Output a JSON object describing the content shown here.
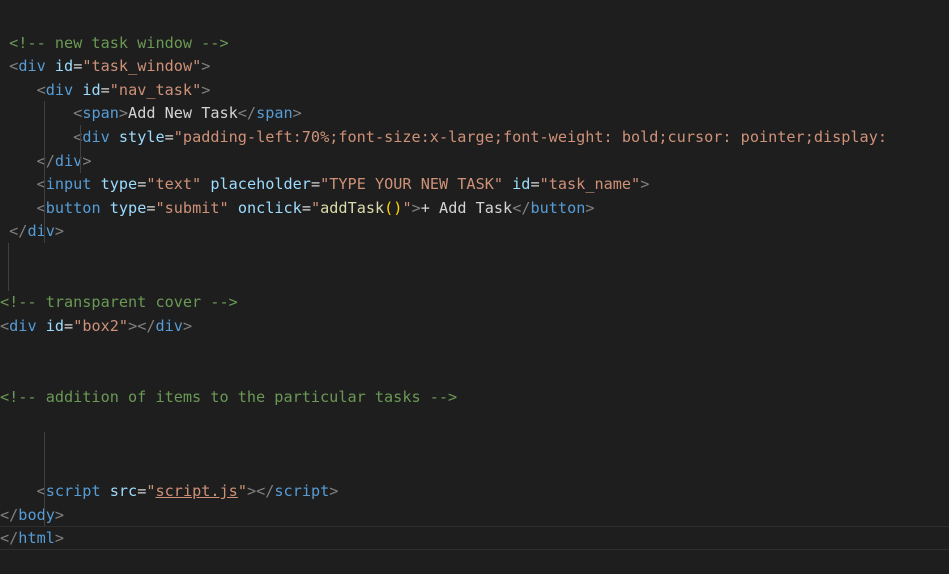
{
  "code_lines": [
    {
      "id": "l01",
      "kind": "blank",
      "tokens": []
    },
    {
      "id": "l02",
      "kind": "comment",
      "tokens": [
        {
          "t": "c",
          "v": " <!-- new task window -->"
        }
      ]
    },
    {
      "id": "l03",
      "kind": "tag",
      "tokens": [
        {
          "t": "txt",
          "v": " "
        },
        {
          "t": "p",
          "v": "<"
        },
        {
          "t": "tag",
          "v": "div"
        },
        {
          "t": "txt",
          "v": " "
        },
        {
          "t": "attr",
          "v": "id"
        },
        {
          "t": "txt",
          "v": "="
        },
        {
          "t": "str",
          "v": "\"task_window\""
        },
        {
          "t": "p",
          "v": ">"
        }
      ]
    },
    {
      "id": "l04",
      "kind": "tag",
      "tokens": [
        {
          "t": "txt",
          "v": "    "
        },
        {
          "t": "p",
          "v": "<"
        },
        {
          "t": "tag",
          "v": "div"
        },
        {
          "t": "txt",
          "v": " "
        },
        {
          "t": "attr",
          "v": "id"
        },
        {
          "t": "txt",
          "v": "="
        },
        {
          "t": "str",
          "v": "\"nav_task\""
        },
        {
          "t": "p",
          "v": ">"
        }
      ]
    },
    {
      "id": "l05",
      "kind": "tag",
      "tokens": [
        {
          "t": "txt",
          "v": "        "
        },
        {
          "t": "p",
          "v": "<"
        },
        {
          "t": "tag",
          "v": "span"
        },
        {
          "t": "p",
          "v": ">"
        },
        {
          "t": "txt",
          "v": "Add New Task"
        },
        {
          "t": "p",
          "v": "</"
        },
        {
          "t": "tag",
          "v": "span"
        },
        {
          "t": "p",
          "v": ">"
        }
      ]
    },
    {
      "id": "l06",
      "kind": "tag",
      "tokens": [
        {
          "t": "txt",
          "v": "        "
        },
        {
          "t": "p",
          "v": "<"
        },
        {
          "t": "tag",
          "v": "div"
        },
        {
          "t": "txt",
          "v": " "
        },
        {
          "t": "attr",
          "v": "style"
        },
        {
          "t": "txt",
          "v": "="
        },
        {
          "t": "str",
          "v": "\"padding-left:70%;font-size:x-large;font-weight: bold;cursor: pointer;display: "
        }
      ]
    },
    {
      "id": "l07",
      "kind": "tag",
      "tokens": [
        {
          "t": "txt",
          "v": "    "
        },
        {
          "t": "p",
          "v": "</"
        },
        {
          "t": "tag",
          "v": "div"
        },
        {
          "t": "p",
          "v": ">"
        }
      ]
    },
    {
      "id": "l08",
      "kind": "tag",
      "tokens": [
        {
          "t": "txt",
          "v": "    "
        },
        {
          "t": "p",
          "v": "<"
        },
        {
          "t": "tag",
          "v": "input"
        },
        {
          "t": "txt",
          "v": " "
        },
        {
          "t": "attr",
          "v": "type"
        },
        {
          "t": "txt",
          "v": "="
        },
        {
          "t": "str",
          "v": "\"text\""
        },
        {
          "t": "txt",
          "v": " "
        },
        {
          "t": "attr",
          "v": "placeholder"
        },
        {
          "t": "txt",
          "v": "="
        },
        {
          "t": "str",
          "v": "\"TYPE YOUR NEW TASK\""
        },
        {
          "t": "txt",
          "v": " "
        },
        {
          "t": "attr",
          "v": "id"
        },
        {
          "t": "txt",
          "v": "="
        },
        {
          "t": "str",
          "v": "\"task_name\""
        },
        {
          "t": "p",
          "v": ">"
        }
      ]
    },
    {
      "id": "l09",
      "kind": "tag",
      "tokens": [
        {
          "t": "txt",
          "v": "    "
        },
        {
          "t": "p",
          "v": "<"
        },
        {
          "t": "tag",
          "v": "button"
        },
        {
          "t": "txt",
          "v": " "
        },
        {
          "t": "attr",
          "v": "type"
        },
        {
          "t": "txt",
          "v": "="
        },
        {
          "t": "str",
          "v": "\"submit\""
        },
        {
          "t": "txt",
          "v": " "
        },
        {
          "t": "attr",
          "v": "onclick"
        },
        {
          "t": "txt",
          "v": "="
        },
        {
          "t": "str",
          "v": "\""
        },
        {
          "t": "fn",
          "v": "addTask"
        },
        {
          "t": "brk",
          "v": "()"
        },
        {
          "t": "str",
          "v": "\""
        },
        {
          "t": "p",
          "v": ">"
        },
        {
          "t": "txt",
          "v": "+ Add Task"
        },
        {
          "t": "p",
          "v": "</"
        },
        {
          "t": "tag",
          "v": "button"
        },
        {
          "t": "p",
          "v": ">"
        }
      ]
    },
    {
      "id": "l10",
      "kind": "tag",
      "tokens": [
        {
          "t": "txt",
          "v": " "
        },
        {
          "t": "p",
          "v": "</"
        },
        {
          "t": "tag",
          "v": "div"
        },
        {
          "t": "p",
          "v": ">"
        }
      ]
    },
    {
      "id": "l11",
      "kind": "blank",
      "tokens": []
    },
    {
      "id": "l12",
      "kind": "blank",
      "tokens": []
    },
    {
      "id": "l13",
      "kind": "comment",
      "tokens": [
        {
          "t": "c",
          "v": "<!-- transparent cover -->"
        }
      ]
    },
    {
      "id": "l14",
      "kind": "tag",
      "tokens": [
        {
          "t": "p",
          "v": "<"
        },
        {
          "t": "tag",
          "v": "div"
        },
        {
          "t": "txt",
          "v": " "
        },
        {
          "t": "attr",
          "v": "id"
        },
        {
          "t": "txt",
          "v": "="
        },
        {
          "t": "str",
          "v": "\"box2\""
        },
        {
          "t": "p",
          "v": "></"
        },
        {
          "t": "tag",
          "v": "div"
        },
        {
          "t": "p",
          "v": ">"
        }
      ]
    },
    {
      "id": "l15",
      "kind": "blank",
      "tokens": []
    },
    {
      "id": "l16",
      "kind": "blank",
      "tokens": []
    },
    {
      "id": "l17",
      "kind": "comment",
      "tokens": [
        {
          "t": "c",
          "v": "<!-- addition of items to the particular tasks -->"
        }
      ]
    },
    {
      "id": "l18",
      "kind": "blank",
      "tokens": []
    },
    {
      "id": "l19",
      "kind": "blank",
      "tokens": []
    },
    {
      "id": "l20",
      "kind": "blank",
      "tokens": []
    },
    {
      "id": "l21",
      "kind": "tag",
      "tokens": [
        {
          "t": "txt",
          "v": "    "
        },
        {
          "t": "p",
          "v": "<"
        },
        {
          "t": "tag",
          "v": "script"
        },
        {
          "t": "txt",
          "v": " "
        },
        {
          "t": "attr",
          "v": "src"
        },
        {
          "t": "txt",
          "v": "="
        },
        {
          "t": "str",
          "v": "\""
        },
        {
          "t": "strU",
          "v": "script.js"
        },
        {
          "t": "str",
          "v": "\""
        },
        {
          "t": "p",
          "v": "></"
        },
        {
          "t": "tag",
          "v": "script"
        },
        {
          "t": "p",
          "v": ">"
        }
      ]
    },
    {
      "id": "l22",
      "kind": "tag",
      "tokens": [
        {
          "t": "p",
          "v": "</"
        },
        {
          "t": "tag",
          "v": "body"
        },
        {
          "t": "p",
          "v": ">"
        }
      ]
    },
    {
      "id": "l23",
      "kind": "tag",
      "tokens": [
        {
          "t": "p",
          "v": "</"
        },
        {
          "t": "tag",
          "v": "html"
        },
        {
          "t": "p",
          "v": ">"
        }
      ]
    }
  ],
  "theme": {
    "background": "#1e1e1e",
    "comment": "#6a9955",
    "punctuation": "#808080",
    "tag": "#569cd6",
    "attribute": "#9cdcfe",
    "string": "#ce9178",
    "function": "#dcdcaa",
    "bracket": "#ffd700",
    "text": "#d4d4d4"
  }
}
